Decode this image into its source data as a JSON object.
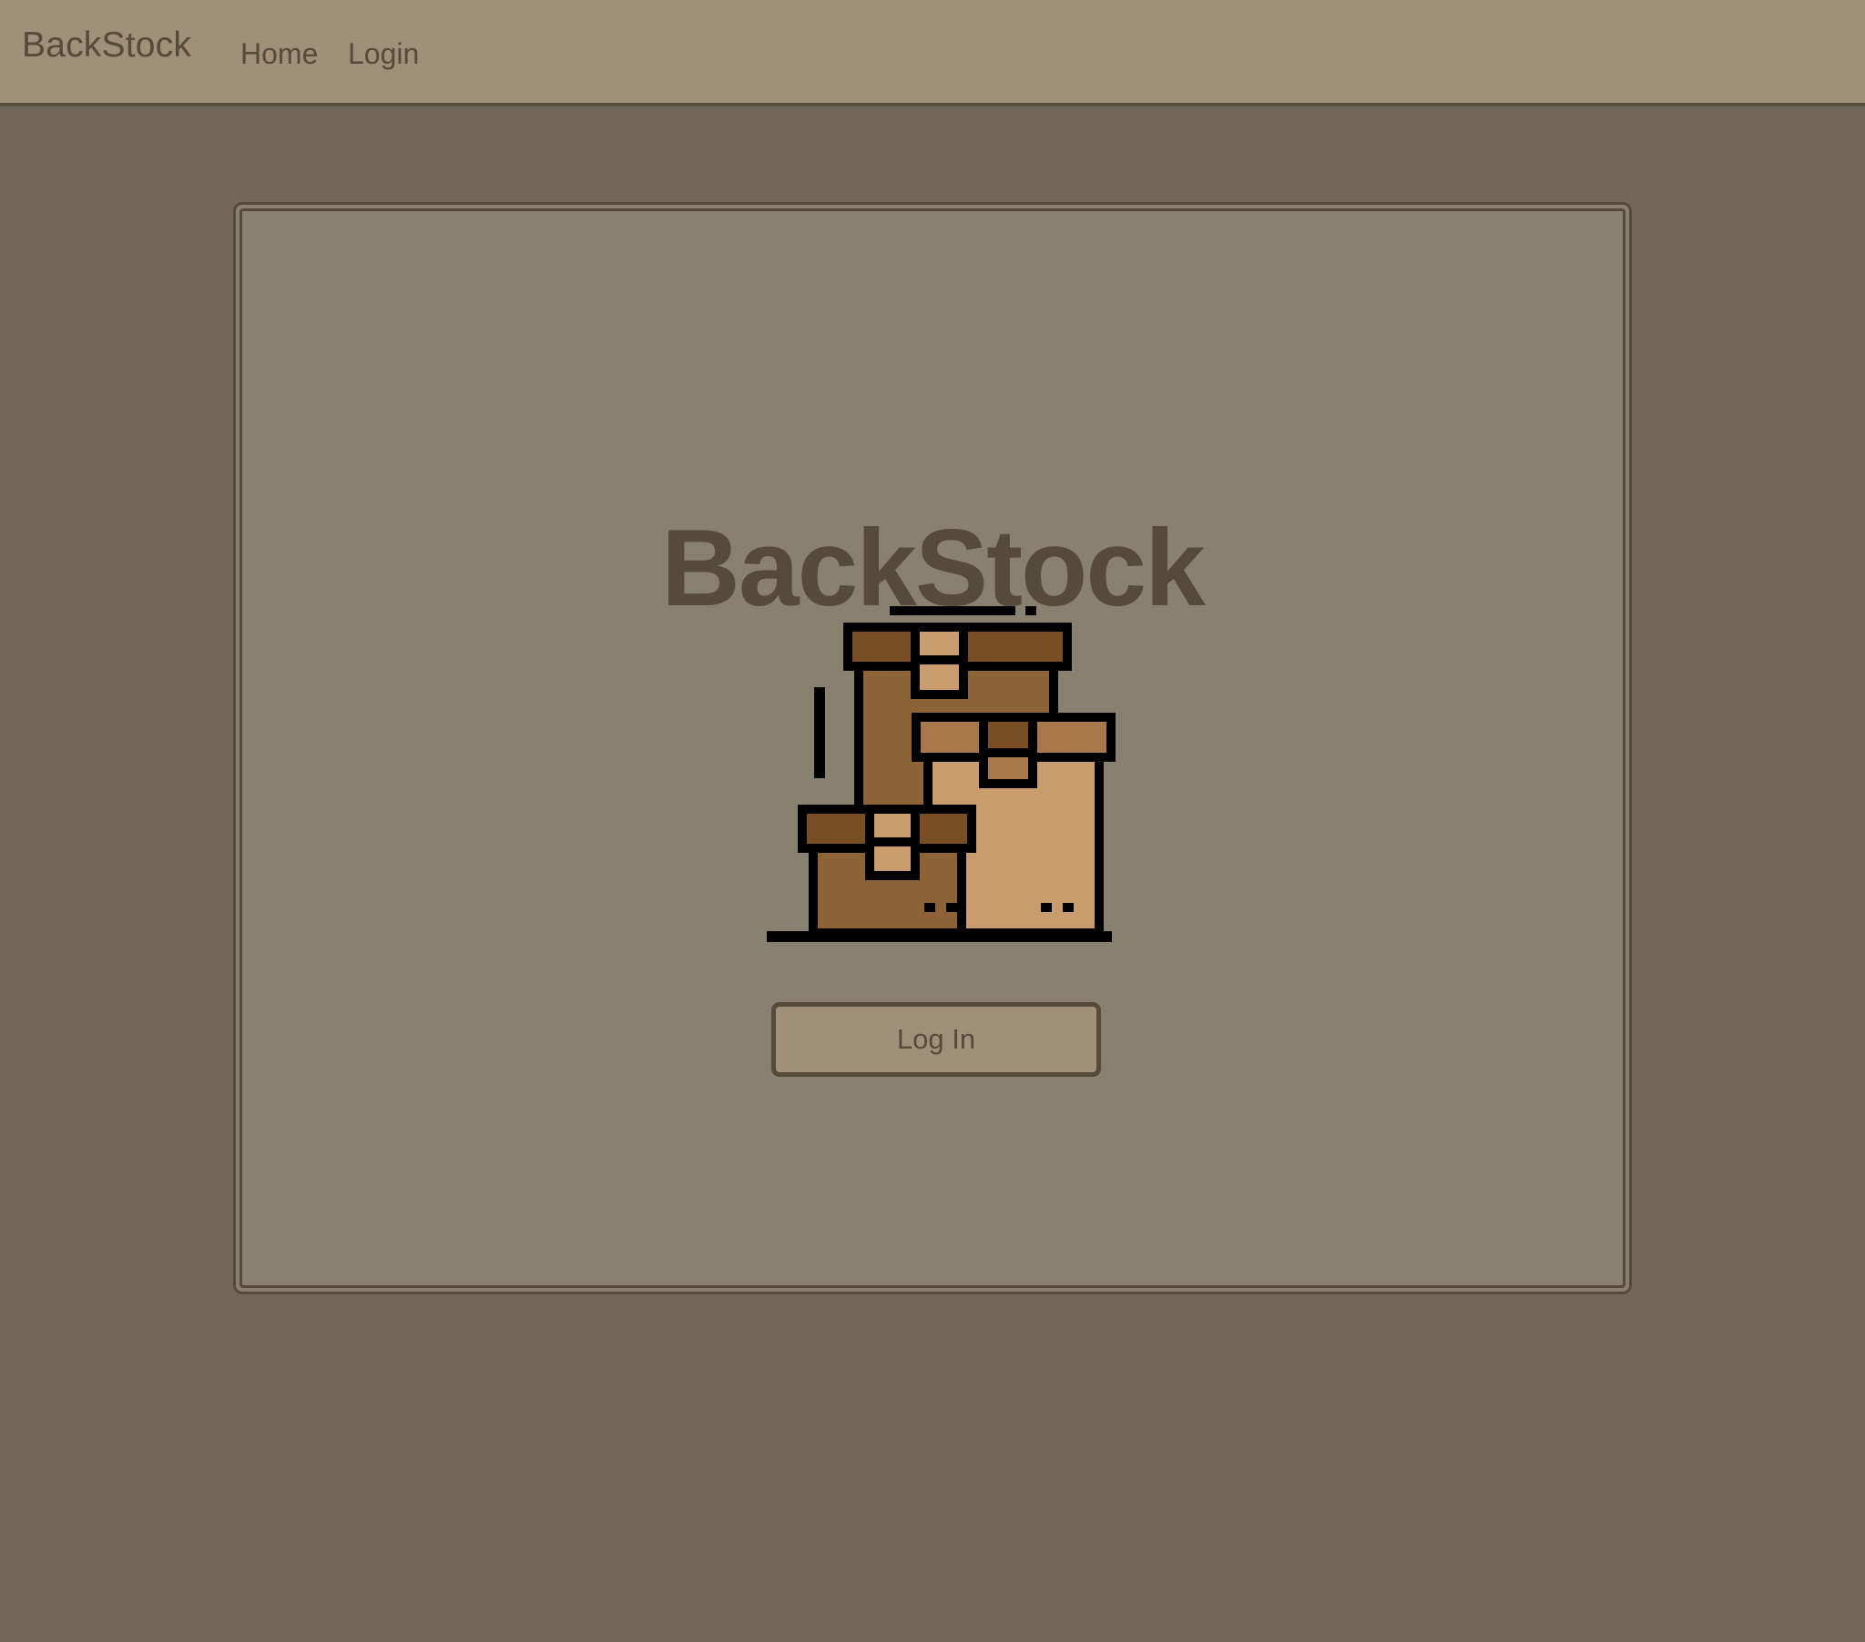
{
  "navbar": {
    "brand": "BackStock",
    "links": [
      {
        "label": "Home"
      },
      {
        "label": "Login"
      }
    ]
  },
  "hero": {
    "title": "BackStock",
    "illustration": "stacked-cardboard-boxes-icon",
    "login_button_label": "Log In"
  },
  "colors": {
    "page_background": "#726959",
    "navbar_background": "#a08f79",
    "card_background": "#898170",
    "text_and_border": "#564a3b",
    "box_dark": "#8d6236",
    "box_darker": "#7a4e25",
    "box_light": "#c89c6c",
    "box_mid": "#a8784b"
  }
}
